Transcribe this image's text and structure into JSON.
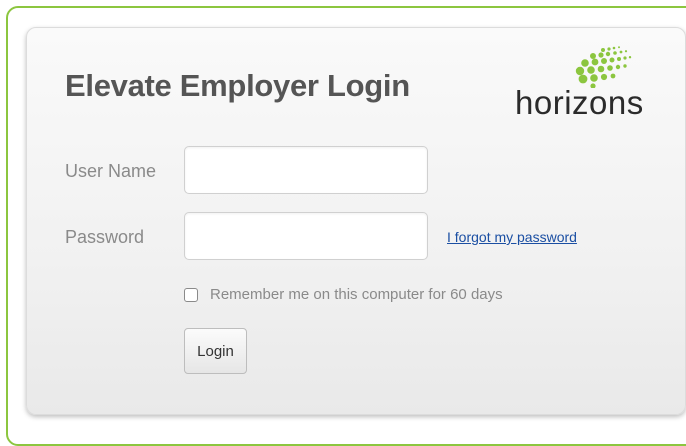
{
  "login": {
    "title": "Elevate Employer Login",
    "username_label": "User Name",
    "username_value": "",
    "password_label": "Password",
    "password_value": "",
    "forgot_link": "I forgot my password",
    "remember_label": "Remember me on this computer for 60 days",
    "remember_checked": false,
    "login_button": "Login"
  },
  "brand": {
    "logo_text": "horizons",
    "logo_icon": "green-dots-icon",
    "accent_color": "#8cc63f"
  }
}
